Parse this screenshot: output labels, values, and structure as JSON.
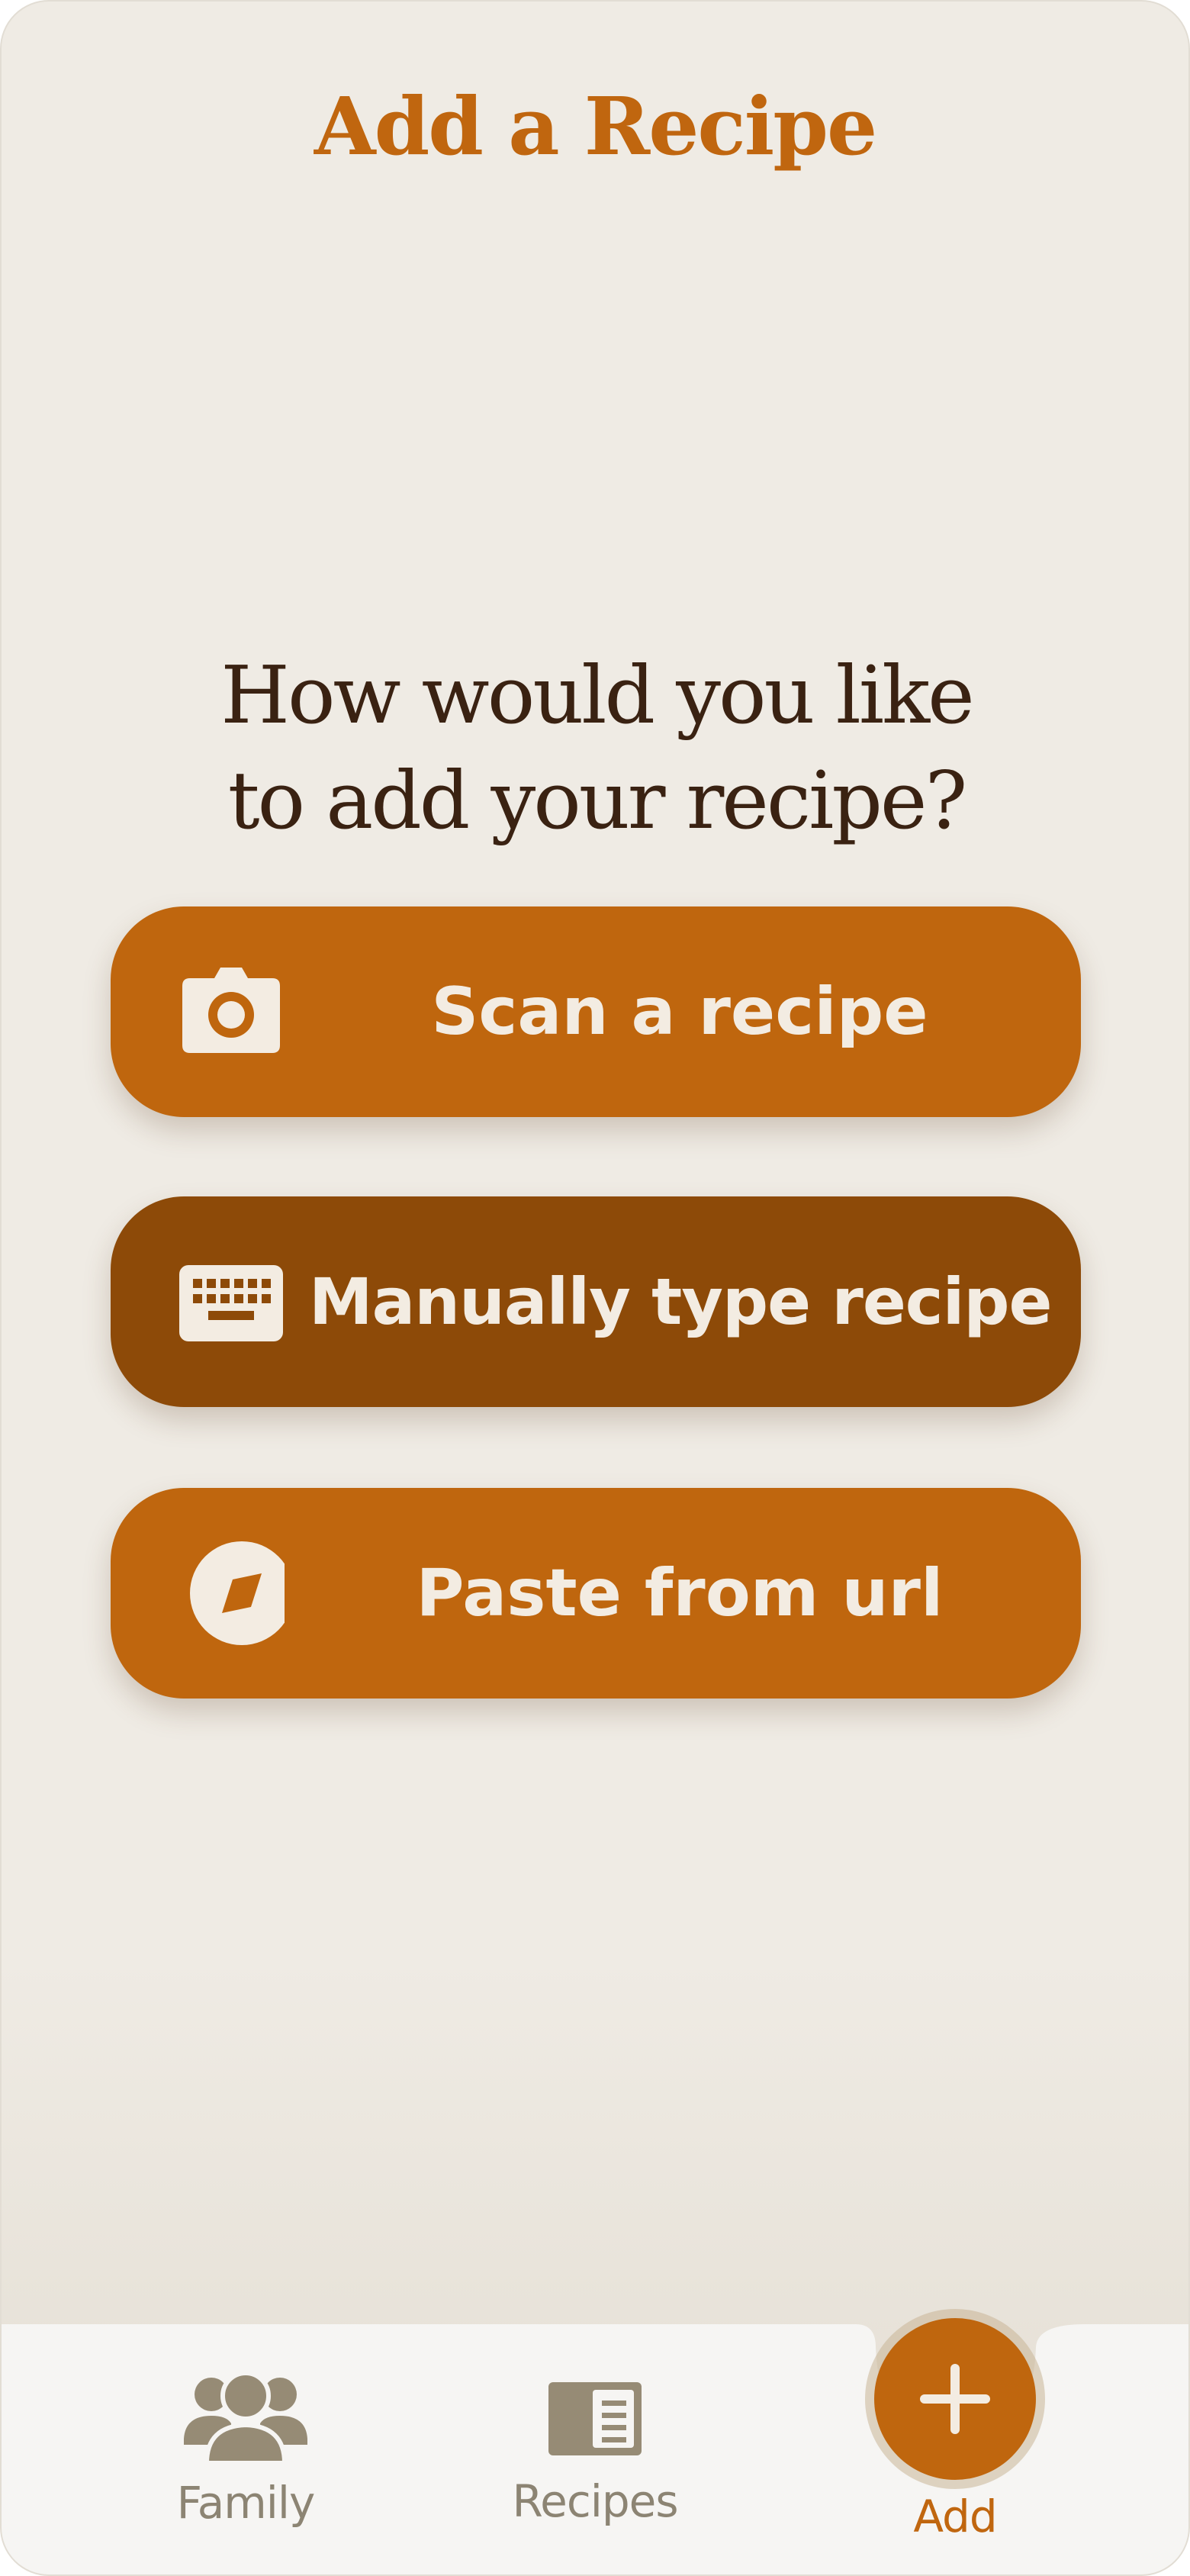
{
  "header": {
    "title": "Add a Recipe"
  },
  "main": {
    "prompt_line1": "How would you like",
    "prompt_line2": "to add your recipe?",
    "options": [
      {
        "label": "Scan a recipe",
        "icon": "camera-icon"
      },
      {
        "label": "Manually type recipe",
        "icon": "keyboard-icon"
      },
      {
        "label": "Paste from url",
        "icon": "compass-icon"
      }
    ]
  },
  "nav": {
    "items": [
      {
        "label": "Family",
        "icon": "people-icon"
      },
      {
        "label": "Recipes",
        "icon": "book-icon"
      },
      {
        "label": "Add",
        "icon": "plus-icon"
      }
    ]
  },
  "colors": {
    "accent": "#bf660e",
    "accent_dark": "#8d4a08",
    "background": "#efebe4",
    "title_text": "#3a2212",
    "nav_inactive": "#8c8473"
  }
}
